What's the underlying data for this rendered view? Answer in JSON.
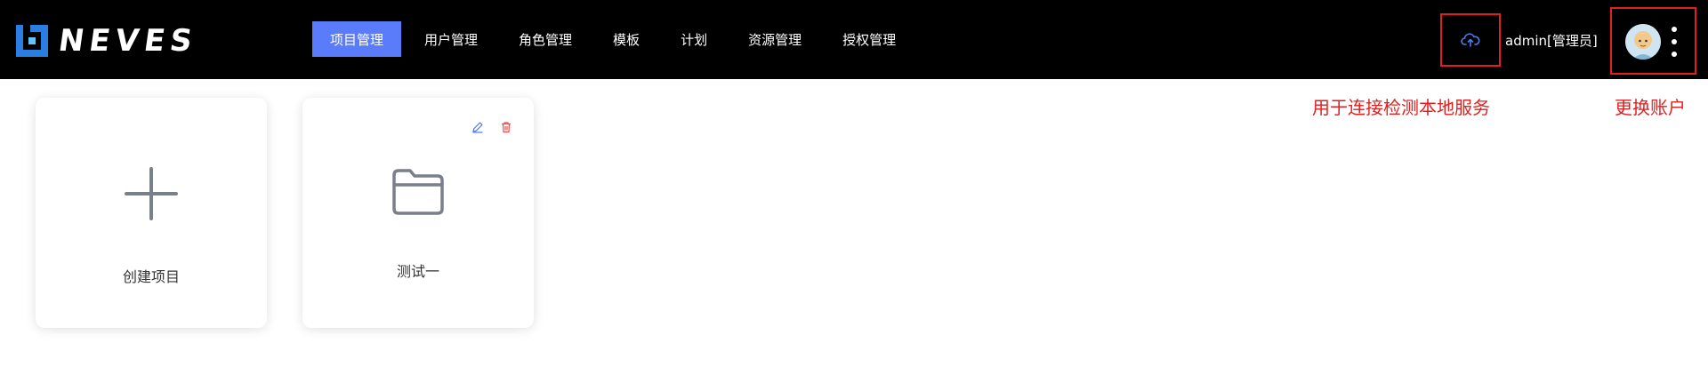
{
  "brand": {
    "name": "NEVES"
  },
  "nav": {
    "items": [
      {
        "label": "项目管理",
        "active": true
      },
      {
        "label": "用户管理",
        "active": false
      },
      {
        "label": "角色管理",
        "active": false
      },
      {
        "label": "模板",
        "active": false
      },
      {
        "label": "计划",
        "active": false
      },
      {
        "label": "资源管理",
        "active": false
      },
      {
        "label": "授权管理",
        "active": false
      }
    ]
  },
  "header": {
    "user": "admin[管理员]",
    "cloud_icon": "cloud-upload-icon",
    "menu_icon": "more-vertical-icon"
  },
  "annotations": {
    "cloud": "用于连接检测本地服务",
    "account": "更换账户"
  },
  "cards": {
    "create": {
      "label": "创建项目",
      "icon": "plus-icon"
    },
    "project": {
      "label": "测试一",
      "icon": "folder-icon",
      "edit_icon": "edit-icon",
      "delete_icon": "trash-icon"
    }
  },
  "colors": {
    "accent": "#5b7cfa",
    "annotation": "#e02020",
    "header_bg": "#000000",
    "edit": "#4a7cf0",
    "delete": "#f04a4a"
  }
}
